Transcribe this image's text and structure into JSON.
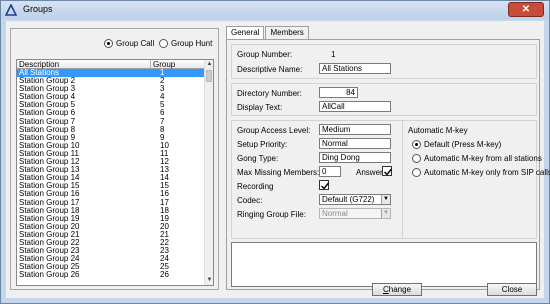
{
  "window": {
    "title": "Groups",
    "close_glyph": "✕"
  },
  "mode": {
    "group_call_label": "Group Call",
    "group_hunt_label": "Group Hunt",
    "selected": "group_call"
  },
  "list": {
    "col_description": "Description",
    "col_group_number": "Group Number",
    "rows": [
      {
        "description": "All Stations",
        "number": "1",
        "selected": true
      },
      {
        "description": "Station Group 2",
        "number": "2"
      },
      {
        "description": "Station Group 3",
        "number": "3"
      },
      {
        "description": "Station Group 4",
        "number": "4"
      },
      {
        "description": "Station Group 5",
        "number": "5"
      },
      {
        "description": "Station Group 6",
        "number": "6"
      },
      {
        "description": "Station Group 7",
        "number": "7"
      },
      {
        "description": "Station Group 8",
        "number": "8"
      },
      {
        "description": "Station Group 9",
        "number": "9"
      },
      {
        "description": "Station Group 10",
        "number": "10"
      },
      {
        "description": "Station Group 11",
        "number": "11"
      },
      {
        "description": "Station Group 12",
        "number": "12"
      },
      {
        "description": "Station Group 13",
        "number": "13"
      },
      {
        "description": "Station Group 14",
        "number": "14"
      },
      {
        "description": "Station Group 15",
        "number": "15"
      },
      {
        "description": "Station Group 16",
        "number": "16"
      },
      {
        "description": "Station Group 17",
        "number": "17"
      },
      {
        "description": "Station Group 18",
        "number": "18"
      },
      {
        "description": "Station Group 19",
        "number": "19"
      },
      {
        "description": "Station Group 20",
        "number": "20"
      },
      {
        "description": "Station Group 21",
        "number": "21"
      },
      {
        "description": "Station Group 22",
        "number": "22"
      },
      {
        "description": "Station Group 23",
        "number": "23"
      },
      {
        "description": "Station Group 24",
        "number": "24"
      },
      {
        "description": "Station Group 25",
        "number": "25"
      },
      {
        "description": "Station Group 26",
        "number": "26"
      }
    ]
  },
  "tabs": {
    "general": "General",
    "members": "Members"
  },
  "general": {
    "group_number_label": "Group Number:",
    "group_number_value": "1",
    "descriptive_name_label": "Descriptive Name:",
    "descriptive_name_value": "All Stations",
    "directory_number_label": "Directory Number:",
    "directory_number_value": "84",
    "display_text_label": "Display Text:",
    "display_text_value": "AllCall",
    "access_level_label": "Group Access Level:",
    "access_level_value": "Medium",
    "setup_priority_label": "Setup Priority:",
    "setup_priority_value": "Normal",
    "gong_type_label": "Gong Type:",
    "gong_type_value": "Ding Dong",
    "max_missing_label": "Max Missing Members:",
    "max_missing_value": "0",
    "answer_label": "Answer",
    "recording_label": "Recording",
    "codec_label": "Codec:",
    "codec_value": "Default (G722)",
    "ringing_label": "Ringing Group File:",
    "ringing_value": "Normal",
    "mkey_title": "Automatic M-key",
    "mkey_options": [
      "Default (Press M-key)",
      "Automatic M-key from all stations",
      "Automatic M-key only from SIP calls"
    ],
    "mkey_selected": 0
  },
  "buttons": {
    "change_rest": "hange",
    "change_key": "C",
    "close": "Close"
  }
}
